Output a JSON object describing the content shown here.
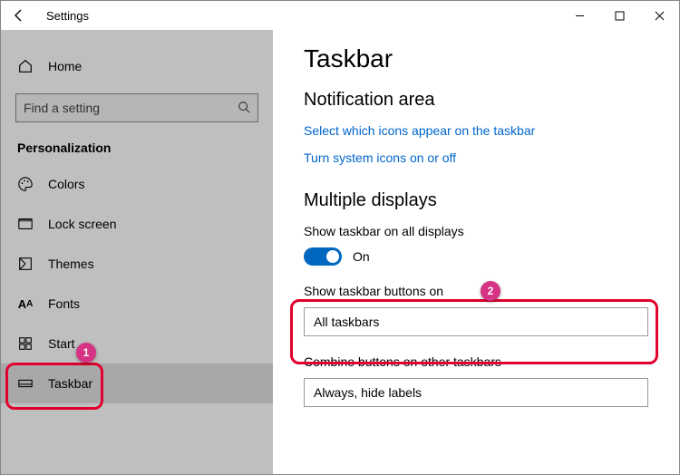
{
  "window": {
    "title": "Settings"
  },
  "sidebar": {
    "home": "Home",
    "search_placeholder": "Find a setting",
    "section": "Personalization",
    "items": [
      {
        "label": "Colors"
      },
      {
        "label": "Lock screen"
      },
      {
        "label": "Themes"
      },
      {
        "label": "Fonts"
      },
      {
        "label": "Start"
      },
      {
        "label": "Taskbar"
      }
    ]
  },
  "content": {
    "title": "Taskbar",
    "notification_area": {
      "heading": "Notification area",
      "link1": "Select which icons appear on the taskbar",
      "link2": "Turn system icons on or off"
    },
    "multiple_displays": {
      "heading": "Multiple displays",
      "show_all_label": "Show taskbar on all displays",
      "show_all_state": "On",
      "show_buttons_label": "Show taskbar buttons on",
      "show_buttons_value": "All taskbars",
      "combine_label": "Combine buttons on other taskbars",
      "combine_value": "Always, hide labels"
    }
  },
  "annotations": {
    "badge1": "1",
    "badge2": "2"
  }
}
